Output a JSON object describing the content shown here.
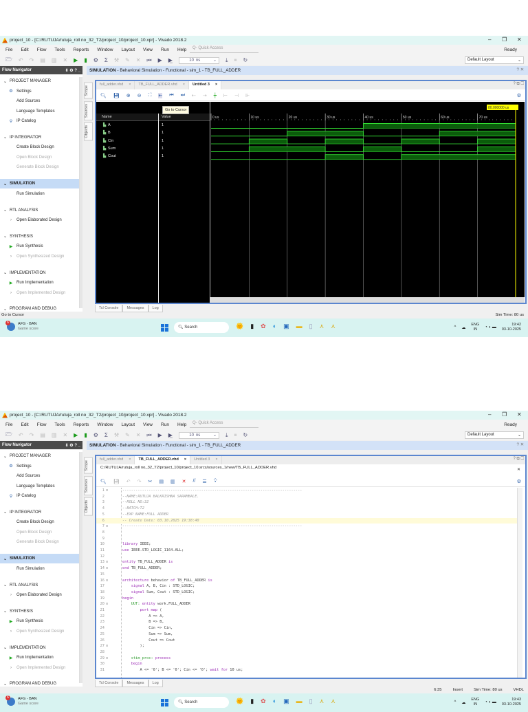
{
  "windows": [
    {
      "title": "project_10 - [C:/RUTUJA/rutuja_roll no_32_T2/project_10/project_10.xpr] - Vivado 2018.2",
      "tabs": [
        {
          "label": "full_adder.vhd"
        },
        {
          "label": "TB_FULL_ADDER.vhd"
        },
        {
          "label": "Untitled 3",
          "active": true
        }
      ],
      "status_left": "Go to Cursor",
      "status_right": [
        "Sim Time: 80 us"
      ],
      "clock_time": "19:42",
      "clock_date": "03-10-2025"
    },
    {
      "title": "project_10 - [C:/RUTUJA/rutuja_roll no_32_T2/project_10/project_10.xpr] - Vivado 2018.2",
      "tabs": [
        {
          "label": "full_adder.vhd"
        },
        {
          "label": "TB_FULL_ADDER.vhd",
          "active": true
        },
        {
          "label": "Untitled 3"
        }
      ],
      "status_left": "",
      "status_right": [
        "6:35",
        "Insert",
        "Sim Time: 80 us",
        "VHDL"
      ],
      "clock_time": "19:43",
      "clock_date": "03-10-2025"
    }
  ],
  "app": {
    "menu": [
      "File",
      "Edit",
      "Flow",
      "Tools",
      "Reports",
      "Window",
      "Layout",
      "View",
      "Run",
      "Help"
    ],
    "quick_access_placeholder": "Q- Quick Access",
    "status_ready": "Ready",
    "run_time_value": "10",
    "run_time_unit": "ns",
    "layout_select": "Default Layout",
    "flow_nav_title": "Flow Navigator",
    "header_bold": "SIMULATION",
    "header_rest": " - Behavioral Simulation - Functional - sim_1 - TB_FULL_ADDER",
    "side_tabs": [
      "Scope",
      "Sources",
      "Objects"
    ],
    "bottom_tabs": [
      "Tcl Console",
      "Messages",
      "Log"
    ],
    "accent": "#5b86cf"
  },
  "sidebar": [
    {
      "label": "PROJECT MANAGER",
      "items": [
        {
          "label": "Settings",
          "icon": "gear"
        },
        {
          "label": "Add Sources"
        },
        {
          "label": "Language Templates"
        },
        {
          "label": "IP Catalog",
          "icon": "plug"
        }
      ]
    },
    {
      "label": "IP INTEGRATOR",
      "items": [
        {
          "label": "Create Block Design"
        },
        {
          "label": "Open Block Design",
          "disabled": true
        },
        {
          "label": "Generate Block Design",
          "disabled": true
        }
      ]
    },
    {
      "label": "SIMULATION",
      "selected": true,
      "items": [
        {
          "label": "Run Simulation"
        }
      ]
    },
    {
      "label": "RTL ANALYSIS",
      "items": [
        {
          "label": "Open Elaborated Design",
          "icon": "chevron"
        }
      ]
    },
    {
      "label": "SYNTHESIS",
      "items": [
        {
          "label": "Run Synthesis",
          "icon": "play"
        },
        {
          "label": "Open Synthesized Design",
          "icon": "chevron",
          "disabled": true
        }
      ]
    },
    {
      "label": "IMPLEMENTATION",
      "items": [
        {
          "label": "Run Implementation",
          "icon": "play"
        },
        {
          "label": "Open Implemented Design",
          "icon": "chevron",
          "disabled": true
        }
      ]
    },
    {
      "label": "PROGRAM AND DEBUG",
      "items": []
    }
  ],
  "taskbar": {
    "widget_title": "AFG - BAN",
    "widget_sub": "Game score",
    "badge": "6",
    "search": "Search",
    "lang": "ENG",
    "region": "IN"
  },
  "waveform": {
    "tooltip": "Go to Cursor",
    "name_header": "Name",
    "value_header": "Value",
    "cursor_label": "80.000000 us",
    "time_unit": "us",
    "time_range": [
      0,
      80
    ],
    "tick_labels": [
      "0 us",
      "10 us",
      "20 us",
      "30 us",
      "40 us",
      "50 us",
      "60 us",
      "70 us"
    ],
    "signals": [
      {
        "name": "A",
        "value": "1",
        "levels": [
          0,
          0,
          0,
          0,
          1,
          1,
          1,
          1
        ]
      },
      {
        "name": "B",
        "value": "1",
        "levels": [
          0,
          0,
          1,
          1,
          0,
          0,
          1,
          1
        ]
      },
      {
        "name": "Cin",
        "value": "1",
        "levels": [
          0,
          1,
          0,
          1,
          0,
          1,
          0,
          1
        ]
      },
      {
        "name": "Sum",
        "value": "1",
        "levels": [
          0,
          1,
          1,
          0,
          1,
          0,
          0,
          1
        ]
      },
      {
        "name": "Cout",
        "value": "1",
        "levels": [
          0,
          0,
          0,
          1,
          0,
          1,
          1,
          1
        ]
      }
    ],
    "colors": {
      "wave": "#33dd33",
      "fill": "#0b5c0b",
      "cursor": "#ffff00"
    }
  },
  "editor": {
    "path": "C:/RUTUJA/rutuja_roll no_32_T2/project_10/project_10.srcs/sources_1/new/TB_FULL_ADDER.vhd",
    "highlighted_line": 6,
    "lines": [
      "----------------------------------------------------------------------------------",
      "--NAME:RUTUJA BALKRISHNA SARAMBALE.",
      "--ROLL NO:32",
      "--BATCH:T2",
      "--EXP NAME:FULL ADDER",
      "-- Create Date: 03.10.2025 19:38:40",
      "----------------------------------------------------------------------------------",
      "",
      "",
      "library IEEE;",
      "use IEEE.STD_LOGIC_1164.ALL;",
      "",
      "entity TB_FULL_ADDER is",
      "end TB_FULL_ADDER;",
      "",
      "architecture behavior of TB_FULL_ADDER is",
      "    signal A, B, Cin : STD_LOGIC;",
      "    signal Sum, Cout : STD_LOGIC;",
      "begin",
      "    UUT: entity work.FULL_ADDER",
      "        port map (",
      "            A => A,",
      "            B => B,",
      "            Cin => Cin,",
      "            Sum => Sum,",
      "            Cout => Cout",
      "        );",
      "",
      "    stim_proc: process",
      "    begin",
      "        A <= '0'; B <= '0'; Cin <= '0'; wait for 10 us;"
    ],
    "fold_lines": [
      1,
      7,
      13,
      14,
      16,
      20,
      27,
      29
    ]
  }
}
